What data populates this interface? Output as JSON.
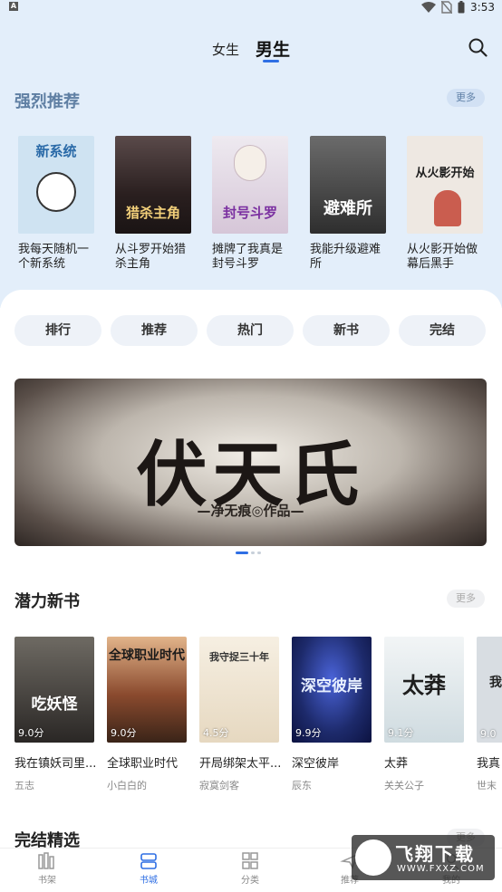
{
  "status_bar": {
    "left_badge": "A",
    "time": "3:53"
  },
  "header": {
    "tabs": [
      {
        "label": "女生",
        "active": false
      },
      {
        "label": "男生",
        "active": true
      }
    ],
    "accent_color": "#2f6fe4"
  },
  "strong_recommend": {
    "title": "强烈推荐",
    "more_label": "更多",
    "books": [
      {
        "name": "我每天随机一个新系统",
        "cover_text": "新系统",
        "cover_color": "#cfe3f2"
      },
      {
        "name": "从斗罗开始猎杀主角",
        "cover_text": "猎杀主角",
        "cover_color": "#3a2c2a"
      },
      {
        "name": "摊牌了我真是封号斗罗",
        "cover_text": "封号斗罗",
        "cover_color": "#e9dde8"
      },
      {
        "name": "我能升级避难所",
        "cover_text": "避难所",
        "cover_color": "#4a4a4a"
      },
      {
        "name": "从火影开始做幕后黑手",
        "cover_text": "从火影开始",
        "cover_color": "#eee8e2"
      }
    ]
  },
  "categories": [
    "排行",
    "推荐",
    "热门",
    "新书",
    "完结"
  ],
  "banner": {
    "title": "伏天氏",
    "subtitle": "—净无痕◎作品—",
    "dots": 3,
    "active_dot": 0
  },
  "potential_new": {
    "title": "潜力新书",
    "more_label": "更多",
    "books": [
      {
        "name": "我在镇妖司里...",
        "author": "五志",
        "score": "9.0分",
        "cover_text": "吃妖怪",
        "cover_color": "#3e3a36"
      },
      {
        "name": "全球职业时代",
        "author": "小白白的",
        "score": "9.0分",
        "cover_text": "全球职业时代",
        "cover_color": "#9a5a3a"
      },
      {
        "name": "开局绑架太平...",
        "author": "寂寞剑客",
        "score": "4.5分",
        "cover_text": "我守捉三十年",
        "cover_color": "#efe6d6"
      },
      {
        "name": "深空彼岸",
        "author": "辰东",
        "score": "9.9分",
        "cover_text": "深空彼岸",
        "cover_color": "#1d2a6b"
      },
      {
        "name": "太莽",
        "author": "关关公子",
        "score": "9.1分",
        "cover_text": "太莽",
        "cover_color": "#e8eef0"
      },
      {
        "name": "我真",
        "author": "世末",
        "score": "9.0",
        "cover_text": "我",
        "cover_color": "#d8dde2"
      }
    ]
  },
  "finished": {
    "title": "完结精选",
    "more_label": "更多"
  },
  "bottom_nav": [
    {
      "label": "书架",
      "icon": "bookshelf-icon",
      "active": false
    },
    {
      "label": "书城",
      "icon": "bookstore-icon",
      "active": true
    },
    {
      "label": "分类",
      "icon": "category-icon",
      "active": false
    },
    {
      "label": "推荐",
      "icon": "recommend-icon",
      "active": false
    },
    {
      "label": "我的",
      "icon": "profile-icon",
      "active": false
    }
  ],
  "watermark": {
    "text": "飞翔下载",
    "url": "WWW.FXXZ.COM"
  }
}
